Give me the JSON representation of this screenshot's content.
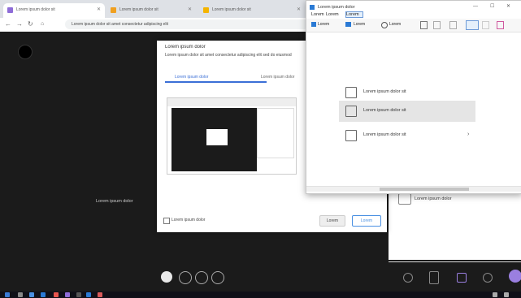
{
  "tabs": [
    {
      "label": "Lorem ipsum dolor sit",
      "active": true,
      "icon": "meeting-app-icon",
      "color": "#8e6cd8"
    },
    {
      "label": "Lorem ipsum dolor sit",
      "active": false,
      "icon": "tab-page-icon",
      "color": "#f0a020"
    },
    {
      "label": "Lorem ipsum dolor sit",
      "active": false,
      "icon": "tab-star-icon",
      "color": "#f4b400"
    }
  ],
  "address": {
    "url": "Lorem ipsum dolor sit amet consectetur adipiscing elit"
  },
  "dialog": {
    "title": "Lorem ipsum dolor",
    "description": "Lorem ipsum dolor sit amet consectetur adipiscing elit sed do eiusmod",
    "tab_screen": "Lorem ipsum dolor",
    "tab_window": "Lorem ipsum dolor",
    "checkbox_label": "Lorem ipsum dolor",
    "cancel_label": "Lorem",
    "share_label": "Lorem"
  },
  "meeting": {
    "caption": "Lorem ipsum dolor"
  },
  "snip": {
    "title": "Lorem ipsum dolor",
    "menu": [
      "Lorem",
      "Lorem",
      "Lorem"
    ],
    "toolbar": [
      "Lorem",
      "Lorem",
      "Lorem"
    ],
    "options": [
      {
        "label": "Lorem ipsum dolor sit",
        "icon": "fullscreen-capture-icon",
        "highlight": false,
        "arrow": false
      },
      {
        "label": "Lorem ipsum dolor sit",
        "icon": "window-capture-icon",
        "highlight": true,
        "arrow": false
      },
      {
        "label": "Lorem ipsum dolor sit",
        "icon": "scrolling-capture-icon",
        "highlight": false,
        "arrow": true
      }
    ]
  },
  "panel": {
    "gallery_label": "Lorem ipsum dolor"
  },
  "colors": {
    "accent": "#7b68ee",
    "dark_bg": "#1b1b1b",
    "share_blue": "#4a90e2"
  }
}
